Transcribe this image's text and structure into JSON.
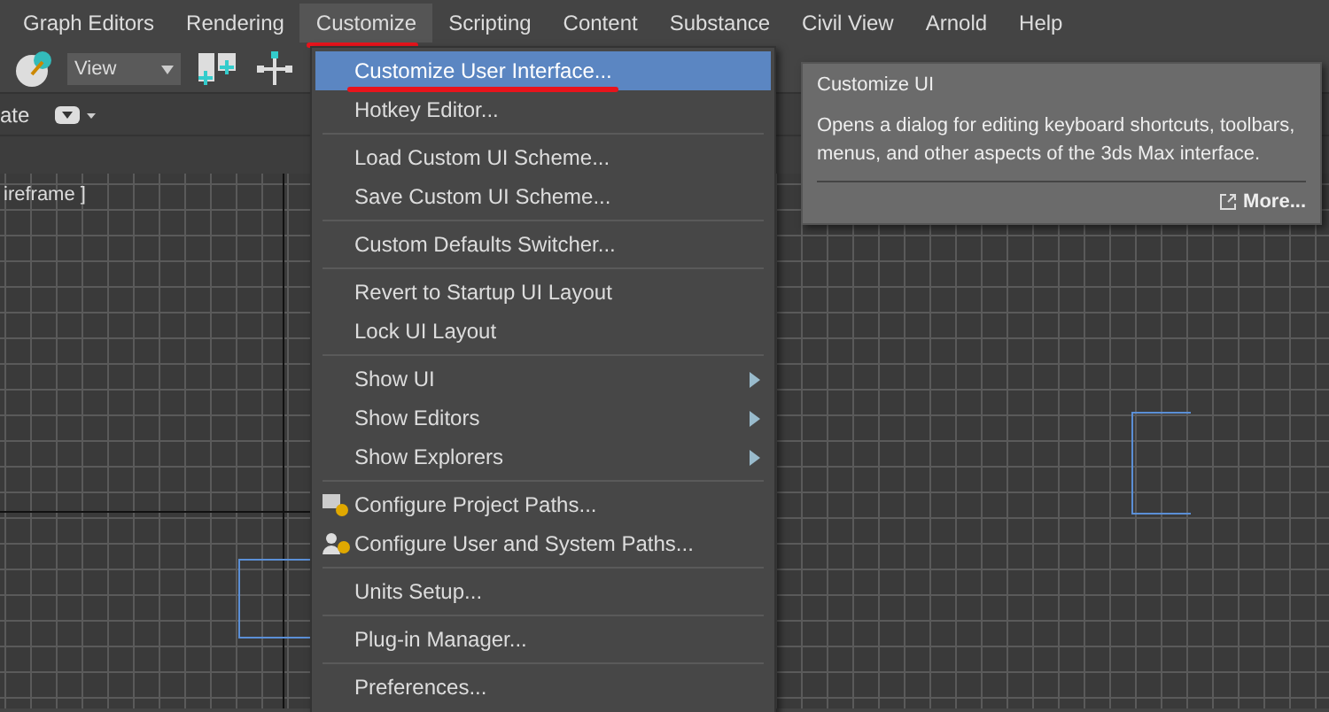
{
  "menubar": [
    {
      "label": "Graph Editors",
      "selected": false,
      "annotated": false
    },
    {
      "label": "Rendering",
      "selected": false,
      "annotated": false
    },
    {
      "label": "Customize",
      "selected": true,
      "annotated": true
    },
    {
      "label": "Scripting",
      "selected": false,
      "annotated": false
    },
    {
      "label": "Content",
      "selected": false,
      "annotated": false
    },
    {
      "label": "Substance",
      "selected": false,
      "annotated": false
    },
    {
      "label": "Civil View",
      "selected": false,
      "annotated": false
    },
    {
      "label": "Arnold",
      "selected": false,
      "annotated": false
    },
    {
      "label": "Help",
      "selected": false,
      "annotated": false
    }
  ],
  "toolbar": {
    "view_dropdown": "View",
    "row2_label": "ate"
  },
  "viewports": [
    {
      "kind": "front",
      "label": "ireframe ]"
    },
    {
      "kind": "right"
    }
  ],
  "menu": {
    "groups": [
      [
        {
          "label": "Customize User Interface...",
          "selected": true,
          "annotated": true,
          "submenu": false,
          "kind": "plain"
        },
        {
          "label": "Hotkey Editor...",
          "selected": false,
          "annotated": false,
          "submenu": false,
          "kind": "plain"
        }
      ],
      [
        {
          "label": "Load Custom UI Scheme...",
          "selected": false,
          "annotated": false,
          "submenu": false,
          "kind": "plain"
        },
        {
          "label": "Save Custom UI Scheme...",
          "selected": false,
          "annotated": false,
          "submenu": false,
          "kind": "plain"
        }
      ],
      [
        {
          "label": "Custom Defaults Switcher...",
          "selected": false,
          "annotated": false,
          "submenu": false,
          "kind": "plain"
        }
      ],
      [
        {
          "label": "Revert to Startup UI Layout",
          "selected": false,
          "annotated": false,
          "submenu": false,
          "kind": "plain"
        },
        {
          "label": "Lock UI Layout",
          "selected": false,
          "annotated": false,
          "submenu": false,
          "kind": "plain"
        }
      ],
      [
        {
          "label": "Show UI",
          "selected": false,
          "annotated": false,
          "submenu": true,
          "kind": "plain"
        },
        {
          "label": "Show Editors",
          "selected": false,
          "annotated": false,
          "submenu": true,
          "kind": "plain"
        },
        {
          "label": "Show Explorers",
          "selected": false,
          "annotated": false,
          "submenu": true,
          "kind": "plain"
        }
      ],
      [
        {
          "label": "Configure Project Paths...",
          "selected": false,
          "annotated": false,
          "submenu": false,
          "kind": "folder"
        },
        {
          "label": "Configure User and System Paths...",
          "selected": false,
          "annotated": false,
          "submenu": false,
          "kind": "user"
        }
      ],
      [
        {
          "label": "Units Setup...",
          "selected": false,
          "annotated": false,
          "submenu": false,
          "kind": "plain"
        }
      ],
      [
        {
          "label": "Plug-in Manager...",
          "selected": false,
          "annotated": false,
          "submenu": false,
          "kind": "plain"
        }
      ],
      [
        {
          "label": "Preferences...",
          "selected": false,
          "annotated": false,
          "submenu": false,
          "kind": "plain"
        }
      ]
    ]
  },
  "tooltip": {
    "title": "Customize UI",
    "body": "Opens a dialog for editing keyboard shortcuts, toolbars, menus, and other aspects of the 3ds Max interface.",
    "link": "More..."
  }
}
